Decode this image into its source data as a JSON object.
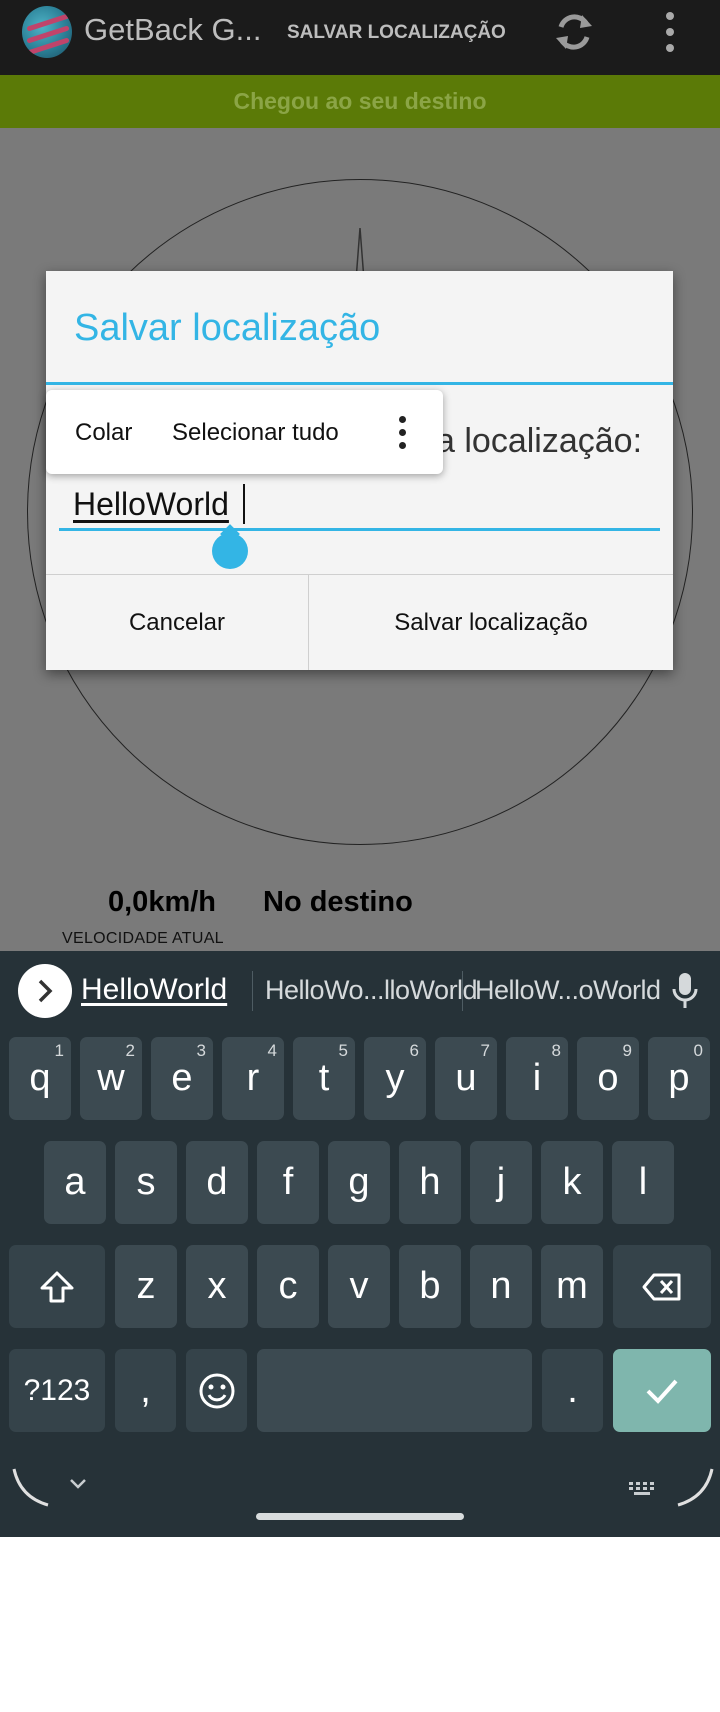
{
  "app_bar": {
    "title": "GetBack G...",
    "action_label": "SALVAR LOCALIZAÇÃO",
    "icons": [
      "app-logo-icon",
      "refresh-icon",
      "overflow-menu-icon"
    ]
  },
  "banner": {
    "text": "Chegou ao seu destino",
    "color": "#5b7a07"
  },
  "status": {
    "speed_value": "0,0km/h",
    "speed_label": "VELOCIDADE ATUAL",
    "destination_status": "No destino"
  },
  "dialog": {
    "title": "Salvar localização",
    "prompt_visible": "a localização:",
    "input_value": "HelloWorld",
    "cancel_label": "Cancelar",
    "save_label": "Salvar localização",
    "accent_color": "#33b5e5"
  },
  "context_menu": {
    "paste": "Colar",
    "select_all": "Selecionar tudo"
  },
  "keyboard": {
    "suggestions": [
      "HelloWorld",
      "HelloWo...lloWorld",
      "HelloW...oWorld"
    ],
    "row1": [
      "q",
      "w",
      "e",
      "r",
      "t",
      "y",
      "u",
      "i",
      "o",
      "p"
    ],
    "row1_hints": [
      "1",
      "2",
      "3",
      "4",
      "5",
      "6",
      "7",
      "8",
      "9",
      "0"
    ],
    "row2": [
      "a",
      "s",
      "d",
      "f",
      "g",
      "h",
      "j",
      "k",
      "l"
    ],
    "row3": [
      "z",
      "x",
      "c",
      "v",
      "b",
      "n",
      "m"
    ],
    "symbols_key": "?123",
    "comma_key": ",",
    "period_key": "."
  }
}
